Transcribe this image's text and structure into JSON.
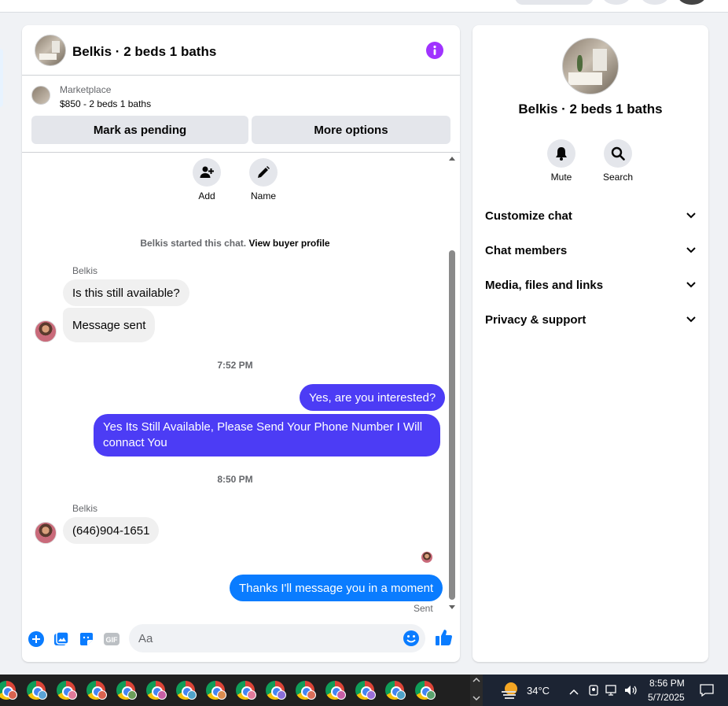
{
  "chat": {
    "title": "Belkis · 2 beds 1 baths",
    "marketplace": {
      "label": "Marketplace",
      "listing": "$850 - 2 beds 1 baths"
    },
    "buttons": {
      "mark_pending": "Mark as pending",
      "more_options": "More options"
    },
    "actions": [
      {
        "label": "Add",
        "icon": "add-person-icon"
      },
      {
        "label": "Name",
        "icon": "pencil-icon"
      }
    ],
    "system": {
      "started": "Belkis started this chat.",
      "link": "View buyer profile"
    },
    "messages": {
      "sender_name": "Belkis",
      "in_1": "Is this still available?",
      "in_2": "Message sent",
      "time_1": "7:52 PM",
      "out_1": "Yes, are you interested?",
      "out_2": "Yes Its Still Available, Please Send Your Phone Number I Will connact You",
      "time_2": "8:50 PM",
      "in_3": "(646)904-1651",
      "out_3": "Thanks I'll message you in a moment",
      "status": "Sent"
    },
    "composer": {
      "placeholder": "Aa",
      "icons": [
        "plus-circle-icon",
        "image-icon",
        "sticker-icon",
        "gif-icon",
        "emoji-icon",
        "thumbs-up-icon"
      ]
    }
  },
  "info": {
    "title": "Belkis · 2 beds 1 baths",
    "actions": [
      {
        "label": "Mute",
        "icon": "bell-icon"
      },
      {
        "label": "Search",
        "icon": "search-icon"
      }
    ],
    "sections": [
      "Customize chat",
      "Chat members",
      "Media, files and links",
      "Privacy & support"
    ]
  },
  "taskbar": {
    "weather": "34°C",
    "time": "8:56 PM",
    "date": "5/7/2025"
  },
  "colors": {
    "accent": "#0a7cff",
    "out_bubble": "#4c3cf5",
    "info": "#a033ff"
  }
}
